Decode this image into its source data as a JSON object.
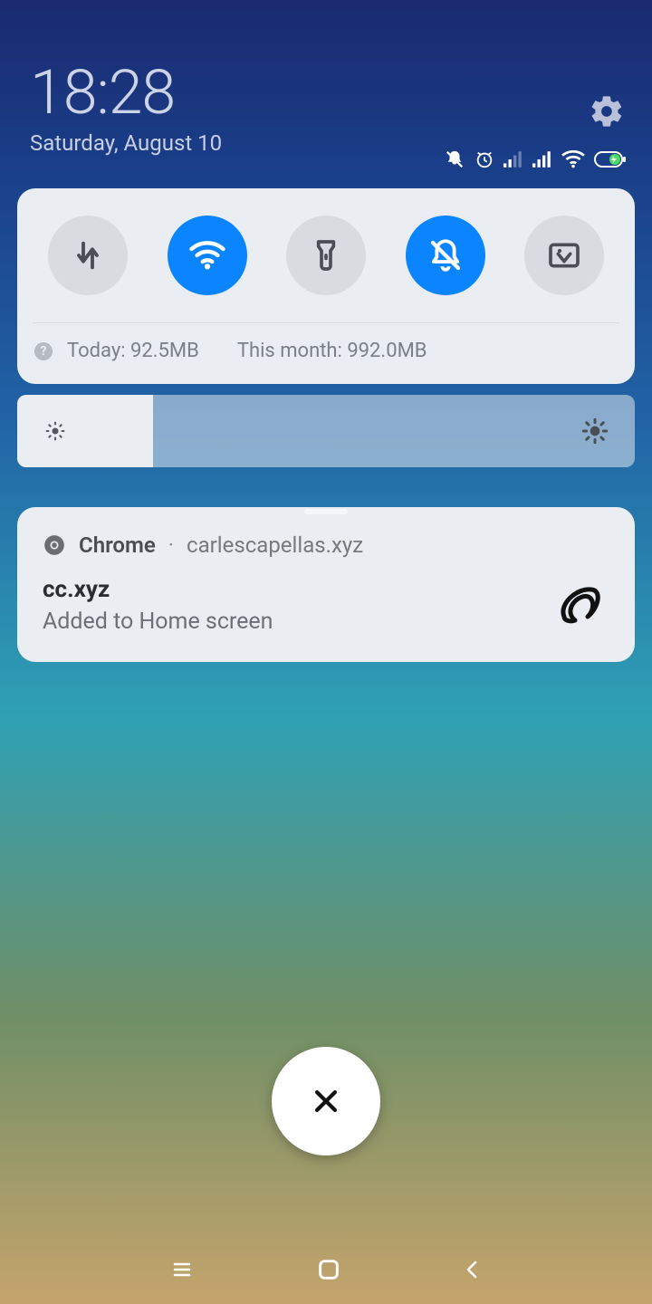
{
  "header": {
    "time": "18:28",
    "date": "Saturday, August 10"
  },
  "status": {
    "dnd_icon": "bell-slash-icon",
    "alarm_icon": "alarm-icon",
    "signal1": "signal-weak-icon",
    "signal2": "signal-strong-icon",
    "wifi": "wifi-icon",
    "battery": "battery-charging-icon"
  },
  "quick_toggles": [
    {
      "name": "mobile-data-toggle",
      "icon": "data-arrows-icon",
      "on": false
    },
    {
      "name": "wifi-toggle",
      "icon": "wifi-icon",
      "on": true
    },
    {
      "name": "flashlight-toggle",
      "icon": "flashlight-icon",
      "on": false
    },
    {
      "name": "dnd-toggle",
      "icon": "bell-slash-icon",
      "on": true
    },
    {
      "name": "screenshot-toggle",
      "icon": "screenshot-icon",
      "on": false
    }
  ],
  "data_usage": {
    "today_label": "Today: 92.5MB",
    "month_label": "This month: 992.0MB"
  },
  "brightness": {
    "level_percent": 22
  },
  "notification": {
    "app_name": "Chrome",
    "separator": "·",
    "site": "carlescapellas.xyz",
    "title": "cc.xyz",
    "subtitle": "Added to Home screen"
  }
}
